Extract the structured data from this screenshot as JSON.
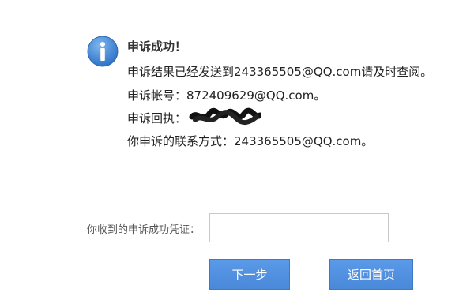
{
  "message": {
    "title": "申诉成功！",
    "result_line": "申诉结果已经发送到243365505@QQ.com请及时查阅。",
    "account_line": "申诉帐号：872409629@QQ.com。",
    "receipt_label": "申诉回执：",
    "contact_line": "你申诉的联系方式：243365505@QQ.com。"
  },
  "form": {
    "voucher_label": "你收到的申诉成功凭证：",
    "voucher_value": ""
  },
  "buttons": {
    "next_label": "下一步",
    "home_label": "返回首页"
  },
  "colors": {
    "icon_blue": "#3f84d6",
    "button_blue": "#4a88d9"
  },
  "icons": {
    "info": "info-circle-icon"
  }
}
